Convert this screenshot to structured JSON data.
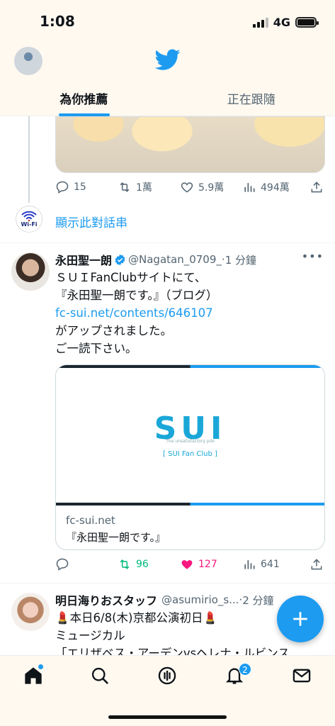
{
  "status_bar": {
    "time": "1:08",
    "network": "4G"
  },
  "header": {
    "tabs": [
      {
        "label": "為你推薦",
        "active": true
      },
      {
        "label": "正在跟隨",
        "active": false
      }
    ],
    "accent_color": "#1d9bf0"
  },
  "thread": {
    "stats": {
      "replies": "15",
      "retweets": "1萬",
      "likes": "5.9萬",
      "views": "494萬"
    },
    "show_thread": "顯示此對話串",
    "avatar_text": "Wi-Fi"
  },
  "tweet1": {
    "name": "永田聖一朗",
    "handle": "@Nagatan_0709_",
    "sep": "·",
    "time": "1 分鐘",
    "lines": [
      "ＳＵＩFanClubサイトにて、",
      "『永田聖一朗です。』（ブログ）",
      "fc-sui.net/contents/646107",
      "がアップされました。",
      "ご一読下さい。"
    ],
    "card": {
      "logo": "SUI",
      "subtitle": "The unsatisfactory pile",
      "club": "[ SUI Fan Club ]",
      "domain": "fc-sui.net",
      "title": "『永田聖一朗です。』"
    },
    "stats": {
      "replies": "",
      "retweets": "96",
      "likes": "127",
      "views": "641"
    }
  },
  "tweet2": {
    "name": "明日海りおスタッフ",
    "handle": "@asumirio_s...",
    "sep": "·",
    "time": "2 分鐘",
    "lines": [
      "💄本日6/8(木)京都公演初日💄",
      "ミュージカル",
      "「エリザベス・アーデンvsヘレナ・ルビンス"
    ]
  },
  "nav": {
    "notifications_badge": "2"
  },
  "colors": {
    "retweet_active": "#00ba7c",
    "like_active": "#f91880"
  }
}
